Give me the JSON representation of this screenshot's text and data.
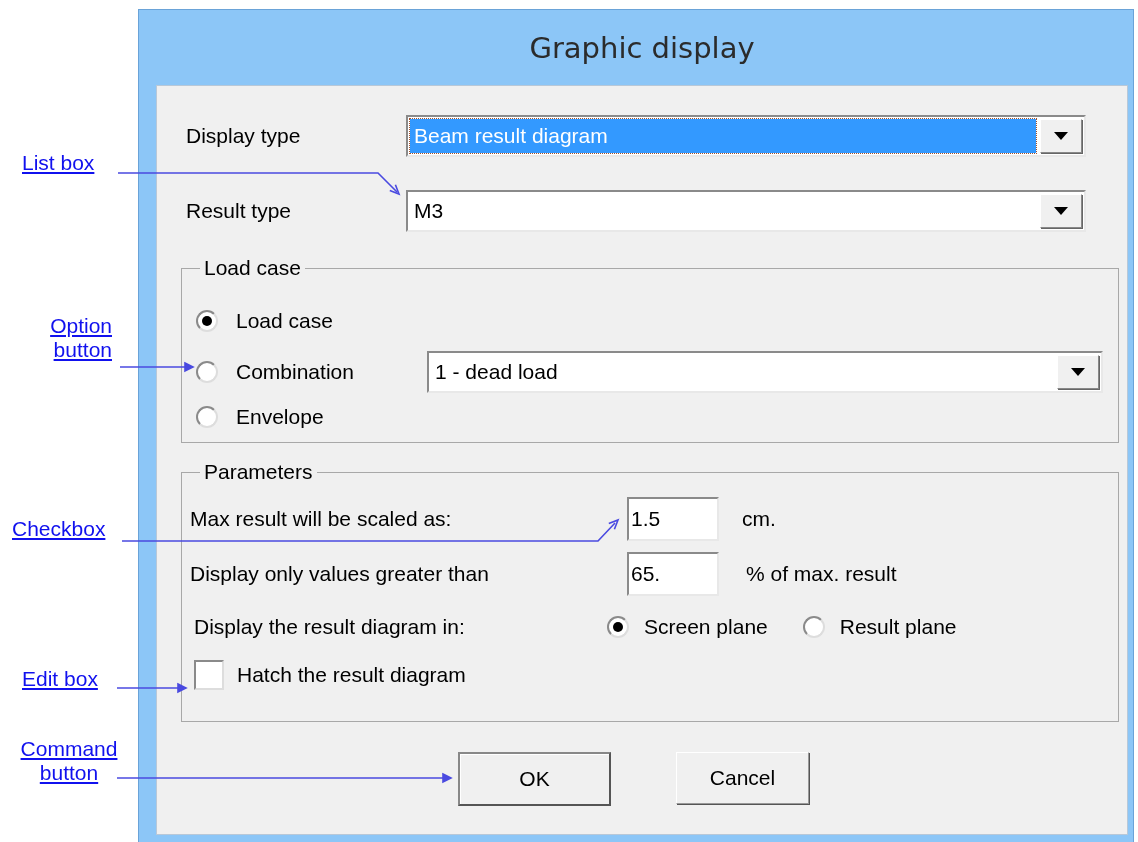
{
  "annotations": [
    {
      "text": "List box"
    },
    {
      "text": "Option button"
    },
    {
      "text": "Checkbox"
    },
    {
      "text": "Edit box"
    },
    {
      "text": "Command button"
    }
  ],
  "dialog": {
    "title": "Graphic display",
    "fields": [
      {
        "label": "Display type",
        "value": "Beam result diagram",
        "focused": true
      },
      {
        "label": "Result type",
        "value": "M3",
        "focused": false
      }
    ],
    "load_case": {
      "legend": "Load case",
      "options": [
        {
          "label": "Load case",
          "selected": true
        },
        {
          "label": "Combination",
          "selected": false
        },
        {
          "label": "Envelope",
          "selected": false
        }
      ],
      "dropdown": "1 - dead load"
    },
    "parameters": {
      "legend": "Parameters",
      "inputs": [
        {
          "label": "Max result will be scaled as:",
          "value": "1.5",
          "unit": "cm."
        },
        {
          "label": "Display only values greater than",
          "value": "65.",
          "unit": "% of max. result"
        }
      ],
      "plane": {
        "label": "Display the result diagram in:",
        "options": [
          {
            "label": "Screen plane",
            "selected": true
          },
          {
            "label": "Result plane",
            "selected": false
          }
        ]
      },
      "hatch": {
        "label": "Hatch the result diagram",
        "checked": false
      }
    },
    "buttons": [
      {
        "label": "OK",
        "default": true
      },
      {
        "label": "Cancel",
        "default": false
      }
    ]
  }
}
